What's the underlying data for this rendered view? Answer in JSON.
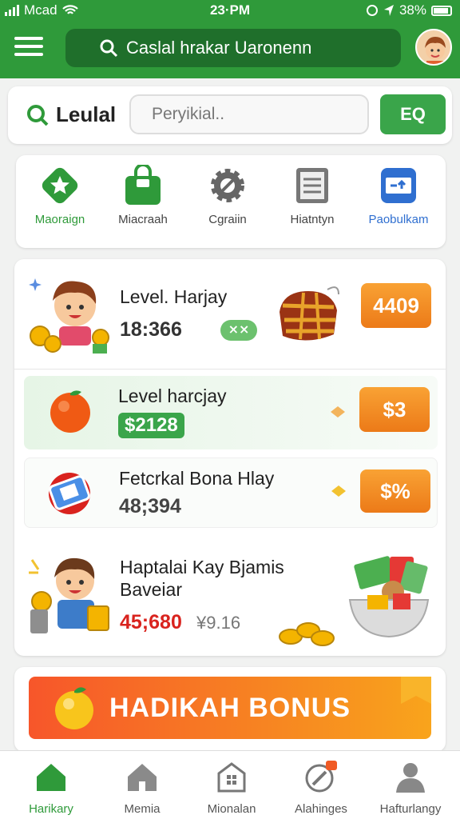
{
  "status": {
    "carrier": "Mcad",
    "time": "23·PM",
    "battery": "38%"
  },
  "header": {
    "search_text": "Caslal hrakar Uaronenn"
  },
  "search": {
    "brand": "Leulal",
    "placeholder": "Peryikial..",
    "button": "EQ"
  },
  "categories": [
    {
      "label": "Maoraign",
      "color": "#2f9a3a"
    },
    {
      "label": "Miacraah",
      "color": "#2f9a3a"
    },
    {
      "label": "Cgraiin",
      "color": "#666666"
    },
    {
      "label": "Hiatntyn",
      "color": "#666666"
    },
    {
      "label": "Paobulkam",
      "color": "#2f6fd0"
    }
  ],
  "rewards": [
    {
      "title": "Level. Harjay",
      "value": "18:366",
      "toggle": "⨯⨯",
      "button": "4409"
    },
    {
      "title": "Level harcjay",
      "value": "$2128",
      "button": "$3"
    },
    {
      "title": "Fetcrkal Bona Hlay",
      "value": "48;394",
      "button": "$%"
    },
    {
      "title_line1": "Haptalai Kay Bjamis",
      "title_line2": "Baveiar",
      "value": "45;680",
      "value2": "¥9.16"
    }
  ],
  "bonus": {
    "label": "HADIKAH BONUS"
  },
  "nav": [
    {
      "label": "Harikary",
      "active": true
    },
    {
      "label": "Memia"
    },
    {
      "label": "Mionalan"
    },
    {
      "label": "Alahinges"
    },
    {
      "label": "Hafturlangy"
    }
  ],
  "colors": {
    "primary": "#2f9a3a",
    "orange": "#f28a1e",
    "red": "#d9231e"
  }
}
